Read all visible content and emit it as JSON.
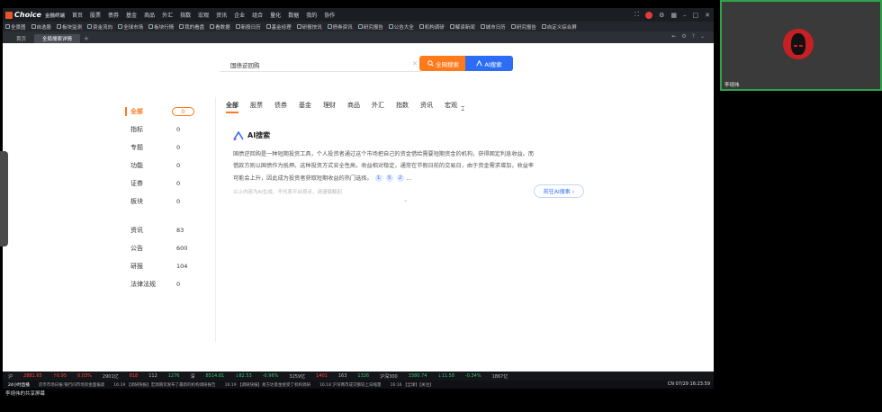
{
  "app": {
    "brand": "Choice",
    "brand_sub": "金融终端",
    "menus": [
      "首页",
      "股票",
      "债券",
      "基金",
      "商品",
      "外汇",
      "指数",
      "宏观",
      "资讯",
      "企业",
      "组合",
      "量化",
      "数据",
      "我的",
      "协作"
    ],
    "window_controls": [
      "⛶",
      "⚙",
      "▦",
      "–",
      "□",
      "✕"
    ],
    "toolbar": [
      "全景图",
      "自选股",
      "板块监测",
      "资金流向",
      "全球市场",
      "板块行情",
      "我的看盘",
      "看数据",
      "新股日历",
      "基金经理",
      "研报快讯",
      "债券资讯",
      "研究报告",
      "公告大全",
      "机构调研",
      "解读新闻",
      "城市日历",
      "研究报告",
      "自定义综合屏"
    ],
    "tabs": [
      {
        "label": "首页",
        "active": false
      },
      {
        "label": "全局搜索详情",
        "active": true
      }
    ],
    "tab_add": "+",
    "tab_right": [
      "⇤",
      "⚙",
      "?",
      "⌄"
    ]
  },
  "search": {
    "query": "国债逆回购",
    "clear": "✕",
    "global_label": "全网搜索",
    "ai_label": "AI搜索"
  },
  "categories": [
    {
      "label": "全部",
      "count": "0",
      "active": true
    },
    {
      "label": "指标",
      "count": "0"
    },
    {
      "label": "专题",
      "count": "0"
    },
    {
      "label": "功能",
      "count": "0"
    },
    {
      "label": "证券",
      "count": "0"
    },
    {
      "label": "板块",
      "count": "0"
    },
    {
      "label": "资讯",
      "count": "83"
    },
    {
      "label": "公告",
      "count": "600"
    },
    {
      "label": "研报",
      "count": "104"
    },
    {
      "label": "法律法规",
      "count": "0"
    }
  ],
  "type_tabs": [
    "全部",
    "股票",
    "债券",
    "基金",
    "理财",
    "商品",
    "外汇",
    "指数",
    "资讯",
    "宏观"
  ],
  "ai_card": {
    "title": "AI搜索",
    "line1": "国债逆回购是一种短期投资工具，个人投资者通过这个市场把自己的资金借给需要短期资金的机构，获得固定利息收益。而",
    "line2": "借款方则以国债作为抵押。这种投资方式安全性高，收益相对稳定，通常在节假日前的交易日，由于资金需求增加，收益率",
    "line3": "可能会上升，因此成为投资者获取短期收益的热门选择。",
    "refs": [
      "1",
      "5",
      "2"
    ],
    "ellipsis": "...",
    "note": "以上内容为AI生成，不代表平台观点，请谨慎甄别",
    "more": "⌄",
    "go_label": "前往AI搜索 ›"
  },
  "ticker": {
    "items": [
      {
        "t": "沪",
        "c": ""
      },
      {
        "t": "2881.65",
        "c": "up"
      },
      {
        "t": "↑0.95",
        "c": "up"
      },
      {
        "t": "0.03%",
        "c": "up"
      },
      {
        "t": "2901亿",
        "c": ""
      },
      {
        "t": "818",
        "c": "up"
      },
      {
        "t": "112",
        "c": ""
      },
      {
        "t": "1276",
        "c": "dn"
      },
      {
        "t": "深",
        "c": ""
      },
      {
        "t": "8514.81",
        "c": "dn"
      },
      {
        "t": "↓82.53",
        "c": "dn"
      },
      {
        "t": "-0.96%",
        "c": "dn"
      },
      {
        "t": "3259亿",
        "c": ""
      },
      {
        "t": "1401",
        "c": "up"
      },
      {
        "t": "163",
        "c": ""
      },
      {
        "t": "1326",
        "c": "dn"
      },
      {
        "t": "沪深300",
        "c": ""
      },
      {
        "t": "3380.74",
        "c": "dn"
      },
      {
        "t": "↓11.58",
        "c": "dn"
      },
      {
        "t": "-0.34%",
        "c": "dn"
      },
      {
        "t": "1867亿",
        "c": ""
      }
    ]
  },
  "news": {
    "lead": "24小时直播",
    "items": [
      "货币市场日报:银行间市场资金面偏紧",
      "16:19 【调研快报】宏源期货发布了最新的机构调研报告",
      "16:19 【调研快报】易方达基金接受了机构调研",
      "16:18 沪深两市成交额较上日缩量",
      "16:16 【全球】【关注】"
    ],
    "status": "CN 07/29 16:23:59"
  },
  "status_caption": "李翊伟的共享屏幕",
  "video": {
    "name": "李翊伟"
  }
}
